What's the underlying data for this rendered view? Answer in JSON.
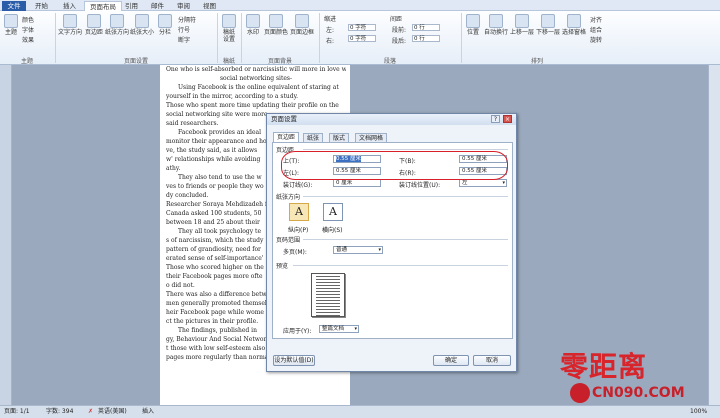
{
  "tabs": {
    "file": "文件",
    "t1": "开始",
    "t2": "插入",
    "t3": "页面布局",
    "t4": "引用",
    "t5": "邮件",
    "t6": "审阅",
    "t7": "视图"
  },
  "ribbon": {
    "theme_label": "主题",
    "colors": "颜色",
    "fonts": "字体",
    "effects": "效果",
    "text_dir": "文字方向",
    "margins": "页边距",
    "orientation": "纸张方向",
    "size": "纸张大小",
    "columns": "分栏",
    "breaks": "分隔符",
    "line_numbers": "行号",
    "hyphen": "断字",
    "paper_setting": "稿纸\n设置",
    "watermark": "水印",
    "page_color": "页面颜色",
    "page_border": "页面边框",
    "indent": "缩进",
    "spacing": "间距",
    "left": "左:",
    "right": "右:",
    "before": "段前:",
    "after": "段后:",
    "indent_left_val": "0 字符",
    "indent_right_val": "0 字符",
    "before_val": "0 行",
    "after_val": "0 行",
    "position": "位置",
    "wrap": "自动换行",
    "bring_forward": "上移一层",
    "send_backward": "下移一层",
    "selection_pane": "选择窗格",
    "align": "对齐",
    "group": "组合",
    "rotate": "旋转",
    "g_theme": "主题",
    "g_page_setup": "页面设置",
    "g_paper": "稿纸",
    "g_page_bg": "页面背景",
    "g_paragraph": "段落",
    "g_arrange": "排列"
  },
  "doc": {
    "lines": [
      "One who is self-absorbed or narcissistic will more in love with",
      "social networking sites-",
      "Using Facebook is the online equivalent of staring at",
      "yourself in the mirror, according to a study.",
      "Those who spent more time updating their profile on the",
      "social networking site were more",
      "said researchers.",
      "Facebook provides an ideal",
      "monitor their appearance and ho",
      "ve, the study said, as it allows",
      "w' relationships while avoiding",
      "athy.",
      "They also tend to use the w",
      "ves to friends or people they wo",
      "dy concluded.",
      "Researcher Soraya Mehdizadeh fr",
      "Canada asked 100 students, 50",
      "between 18 and 25 about their",
      "They all took psychology te",
      "s of narcissism, which the study",
      "pattern of grandiosity, need for",
      "erated sense of self-importance'",
      "Those who scored higher on the",
      "their Facebook pages more ofte",
      "o did not.",
      "There was also a difference betw",
      "men generally promoted themsel",
      "heir Facebook page while wome",
      "ct the pictures in their profile.",
      "The findings, published in",
      "gy, Behaviour And Social Networking, also suggested tha",
      "t those with low self-esteem also checked their Facebook",
      "pages more regularly than normal."
    ]
  },
  "dialog": {
    "title": "页面设置",
    "help": "?",
    "close": "×",
    "tabs": [
      "页边距",
      "纸张",
      "版式",
      "文档网格"
    ],
    "section_margins": "页边距",
    "top_label": "上(T):",
    "top_val": "0.55 厘米",
    "bottom_label": "下(B):",
    "bottom_val": "0.55 厘米",
    "left_label": "左(L):",
    "left_val": "0.55 厘米",
    "right_label": "右(R):",
    "right_val": "0.55 厘米",
    "gutter_label": "装订线(G):",
    "gutter_val": "0 厘米",
    "gutter_pos_label": "装订线位置(U):",
    "gutter_pos_val": "左",
    "section_orientation": "纸张方向",
    "portrait": "纵向(P)",
    "landscape": "横向(S)",
    "section_pages": "页码范围",
    "multiple_label": "多页(M):",
    "multiple_val": "普通",
    "section_preview": "预览",
    "apply_label": "应用于(Y):",
    "apply_val": "整篇文档",
    "default_btn": "设为默认值(D)",
    "ok_btn": "确定",
    "cancel_btn": "取消"
  },
  "status": {
    "page": "页面: 1/1",
    "words": "字数: 394",
    "lang": "英语(美国)",
    "mode": "插入",
    "zoom": "100%"
  },
  "watermark": {
    "title": "零距离",
    "site": "CN090.COM"
  }
}
